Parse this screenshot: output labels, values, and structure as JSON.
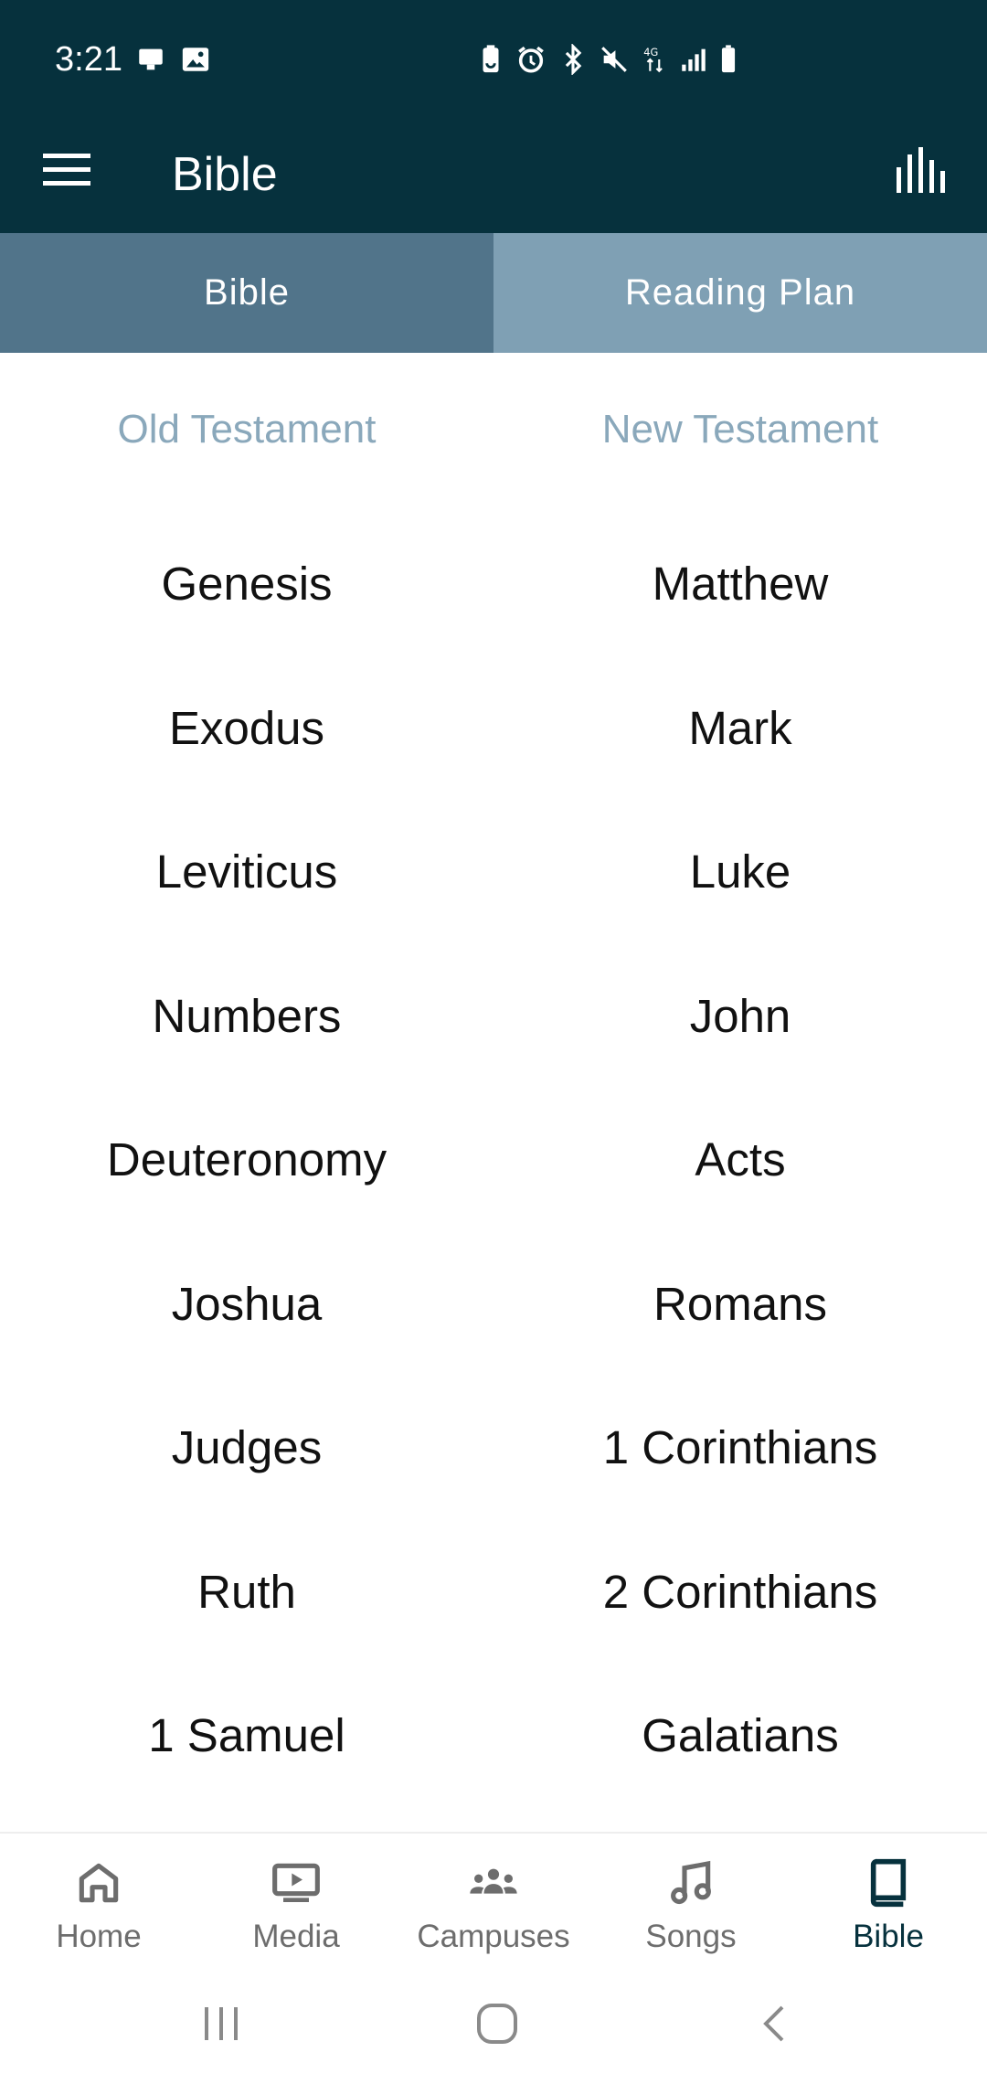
{
  "status_bar": {
    "time": "3:21",
    "icons": [
      "screen-share-icon",
      "gallery-icon",
      "battery-saver-icon",
      "alarm-icon",
      "bluetooth-icon",
      "mute-icon",
      "4g-data-icon",
      "signal-icon",
      "battery-icon"
    ]
  },
  "app_bar": {
    "title": "Bible",
    "left_icon": "hamburger-menu-icon",
    "right_icon": "equalizer-icon"
  },
  "tabs": [
    {
      "label": "Bible",
      "active": true
    },
    {
      "label": "Reading Plan",
      "active": false
    }
  ],
  "testaments": {
    "old": "Old Testament",
    "new": "New Testament"
  },
  "books": {
    "old": [
      "Genesis",
      "Exodus",
      "Leviticus",
      "Numbers",
      "Deuteronomy",
      "Joshua",
      "Judges",
      "Ruth",
      "1 Samuel"
    ],
    "new": [
      "Matthew",
      "Mark",
      "Luke",
      "John",
      "Acts",
      "Romans",
      "1 Corinthians",
      "2 Corinthians",
      "Galatians"
    ]
  },
  "bottom_nav": [
    {
      "label": "Home",
      "icon": "home-icon",
      "active": false
    },
    {
      "label": "Media",
      "icon": "media-icon",
      "active": false
    },
    {
      "label": "Campuses",
      "icon": "campuses-icon",
      "active": false
    },
    {
      "label": "Songs",
      "icon": "music-note-icon",
      "active": false
    },
    {
      "label": "Bible",
      "icon": "book-icon",
      "active": true
    }
  ],
  "colors": {
    "header_bg": "#06313d",
    "tab_active_bg": "#51748a",
    "tab_inactive_bg": "#7fa0b4",
    "testament_label": "#8aa8bb",
    "nav_active": "#06313d",
    "nav_inactive": "#6d6d6d"
  }
}
